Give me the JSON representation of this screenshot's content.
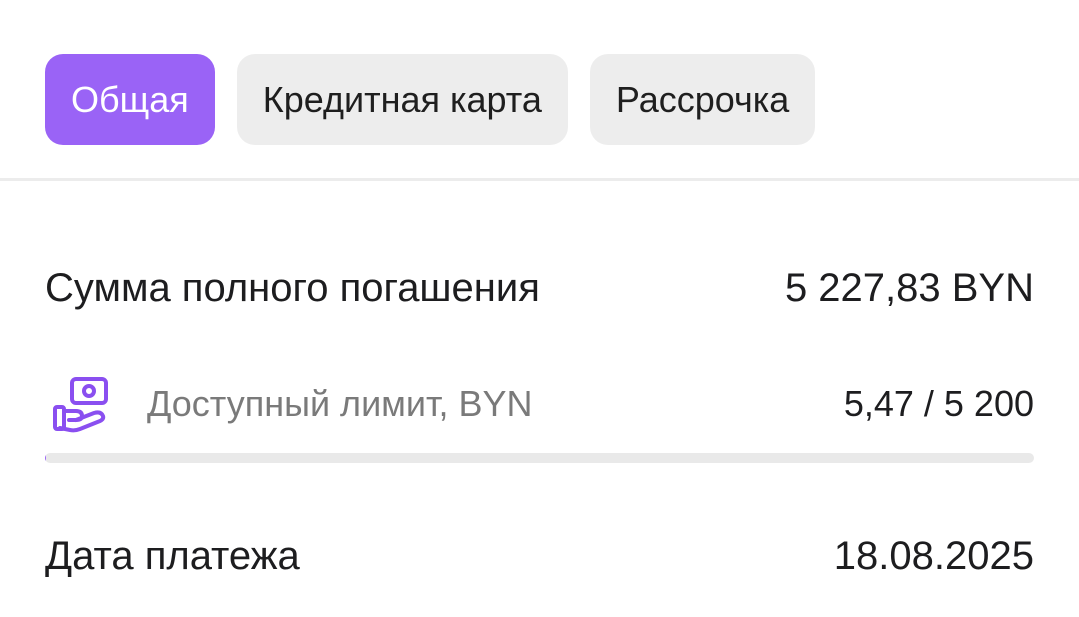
{
  "tabs": [
    {
      "label": "Общая",
      "active": true
    },
    {
      "label": "Кредитная карта",
      "active": false
    },
    {
      "label": "Рассрочка",
      "active": false
    }
  ],
  "summary": {
    "total_label": "Сумма полного погашения",
    "total_value": "5 227,83 BYN",
    "limit_label": "Доступный лимит, BYN",
    "limit_value": "5,47 / 5 200",
    "limit_icon": "money-hand-icon",
    "limit_fraction": 0.00105,
    "date_label": "Дата платежа",
    "date_value": "18.08.2025"
  },
  "colors": {
    "accent": "#9a63f6",
    "tab_inactive_bg": "#ededed",
    "progress_track": "#e9e9e9"
  }
}
